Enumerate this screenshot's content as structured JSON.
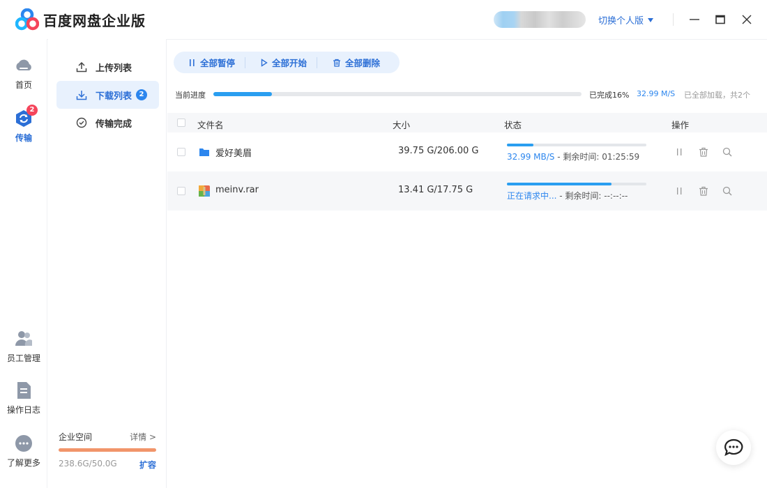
{
  "app": {
    "title": "百度网盘企业版",
    "switch_label": "切换个人版"
  },
  "rail": {
    "items": [
      {
        "label": "首页",
        "icon": "cloud-icon"
      },
      {
        "label": "传输",
        "icon": "transfer-icon",
        "badge": "2"
      },
      {
        "label": "员工管理",
        "icon": "staff-icon"
      },
      {
        "label": "操作日志",
        "icon": "log-icon"
      },
      {
        "label": "了解更多",
        "icon": "more-icon"
      }
    ]
  },
  "transfer_nav": {
    "items": [
      {
        "label": "上传列表",
        "icon": "upload-icon"
      },
      {
        "label": "下载列表",
        "icon": "download-icon",
        "badge": "2"
      },
      {
        "label": "传输完成",
        "icon": "check-circle-icon"
      }
    ]
  },
  "storage": {
    "title": "企业空间",
    "detail": "详情 >",
    "usage": "238.6G/50.0G",
    "expand": "扩容",
    "bar_color": "#f1956a",
    "fill_fraction": 1.0
  },
  "toolbar": {
    "pause_all": "全部暂停",
    "start_all": "全部开始",
    "delete_all": "全部删除"
  },
  "overall": {
    "label": "当前进度",
    "progress": 0.16,
    "done": "已完成16%",
    "speed": "32.99 M/S",
    "loaded": "已全部加载，共2个"
  },
  "table": {
    "columns": {
      "name": "文件名",
      "size": "大小",
      "status": "状态",
      "actions": "操作"
    },
    "rows": [
      {
        "name": "爱好美眉",
        "icon": "folder-icon",
        "size": "39.75 G/206.00 G",
        "progress": 0.19,
        "status_main": "32.99 MB/S",
        "status_rest": " - 剩余时间: 01:25:59"
      },
      {
        "name": "meinv.rar",
        "icon": "archive-icon",
        "size": "13.41 G/17.75 G",
        "progress": 0.75,
        "status_main": "正在请求中...",
        "status_rest": " - 剩余时间: --:--:--"
      }
    ]
  },
  "colors": {
    "accent": "#2c6fd6",
    "progress": "#2a9ef0",
    "badge_red": "#f5455b"
  }
}
